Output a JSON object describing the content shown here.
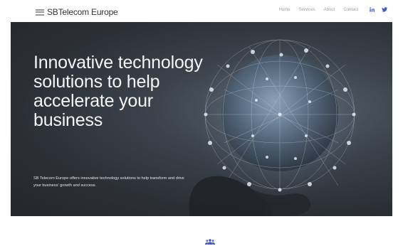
{
  "header": {
    "logo_text": "SBTelecom Europe",
    "nav": [
      "Home",
      "Services",
      "About",
      "Contact"
    ],
    "social": [
      "linkedin-icon",
      "twitter-icon"
    ]
  },
  "hero": {
    "title": "Innovative technology solutions to help accelerate your business",
    "description": "SB Telecom Europe offers innovative technology solutions to help transform and drive your business' growth and success."
  },
  "colors": {
    "accent": "#3a5bd9",
    "hero_bg": "#2f343b",
    "nav_text": "#9aa0a6"
  },
  "icons": {
    "section_icon": "team-icon"
  }
}
